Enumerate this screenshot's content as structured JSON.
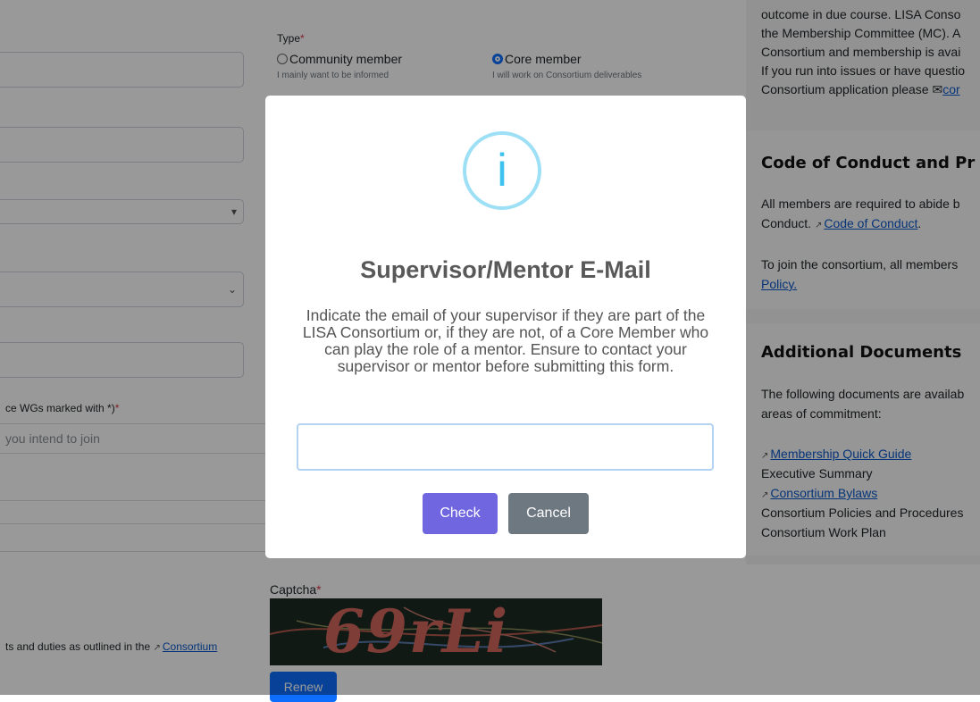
{
  "form": {
    "type_label": "Type",
    "required_mark": "*",
    "radio_community": "Community member",
    "radio_community_sub": "I mainly want to be informed",
    "radio_core": "Core member",
    "radio_core_sub": "I will work on Consortium deliverables",
    "wg_label": "ce WGs marked with *)",
    "wg_placeholder": "you intend to join",
    "captcha_label": "Captcha",
    "captcha_text": "69rLi",
    "renew_button": "Renew",
    "duties_text": "ts and duties as outlined in the",
    "duties_link": "Consortium"
  },
  "sidebar": {
    "intro_lines": [
      "outcome in due course. LISA Conso",
      "the Membership Committee (MC). A",
      "Consortium and membership is avai",
      "If you run into issues or have questio",
      "Consortium application please "
    ],
    "contact_link": "cor",
    "coc_heading": "Code of Conduct and Pr",
    "coc_line1": "All members are required to abide b",
    "coc_line2": "Conduct.",
    "coc_link": "Code of Conduct",
    "coc_line3": "To join the consortium, all members",
    "policy_link": "Policy.",
    "docs_heading": "Additional Documents",
    "docs_line1": "The following documents are availab",
    "docs_line2": "areas of commitment:",
    "doc_quick_guide": "Membership Quick Guide",
    "doc_exec_summary": "Executive Summary",
    "doc_bylaws": "Consortium Bylaws",
    "doc_policies": "Consortium Policies and Procedures",
    "doc_work_plan": "Consortium Work Plan"
  },
  "modal": {
    "icon": "info-icon",
    "icon_glyph": "i",
    "title": "Supervisor/Mentor E-Mail",
    "text": "Indicate the email of your supervisor if they are part of the LISA Consortium or, if they are not, of a Core Member who can play the role of a mentor. Ensure to contact your supervisor or mentor before submitting this form.",
    "input_value": "",
    "check_button": "Check",
    "cancel_button": "Cancel"
  },
  "colors": {
    "confirm": "#7066e0",
    "cancel": "#6e7881",
    "info_icon": "#3fc3ee",
    "link": "#0a58ca"
  }
}
